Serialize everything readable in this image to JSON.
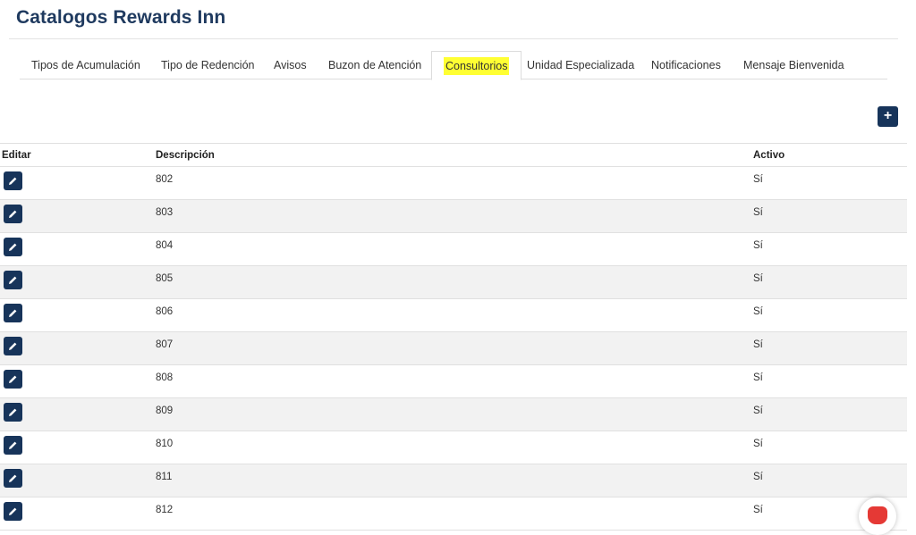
{
  "page": {
    "title": "Catalogos Rewards Inn"
  },
  "tabs": [
    {
      "label": "Tipos de Acumulación"
    },
    {
      "label": "Tipo de Redención"
    },
    {
      "label": "Avisos"
    },
    {
      "label": "Buzon de Atención"
    },
    {
      "label": "Consultorios"
    },
    {
      "label": "Unidad Especializada"
    },
    {
      "label": "Notificaciones"
    },
    {
      "label": "Mensaje Bienvenida"
    }
  ],
  "active_tab": "Consultorios",
  "toolbar": {
    "add_label": "+"
  },
  "table": {
    "headers": {
      "edit": "Editar",
      "description": "Descripción",
      "active": "Activo"
    },
    "rows": [
      {
        "description": "802",
        "active": "Sí"
      },
      {
        "description": "803",
        "active": "Sí"
      },
      {
        "description": "804",
        "active": "Sí"
      },
      {
        "description": "805",
        "active": "Sí"
      },
      {
        "description": "806",
        "active": "Sí"
      },
      {
        "description": "807",
        "active": "Sí"
      },
      {
        "description": "808",
        "active": "Sí"
      },
      {
        "description": "809",
        "active": "Sí"
      },
      {
        "description": "810",
        "active": "Sí"
      },
      {
        "description": "811",
        "active": "Sí"
      },
      {
        "description": "812",
        "active": "Sí"
      }
    ]
  },
  "colors": {
    "primary": "#17345a",
    "title": "#1f3a5f",
    "highlight": "#ffff33",
    "stripe": "#f2f2f2",
    "chat": "#e53935"
  },
  "icons": {
    "edit": "pencil-icon",
    "add": "plus-icon",
    "chat": "chat-icon"
  }
}
